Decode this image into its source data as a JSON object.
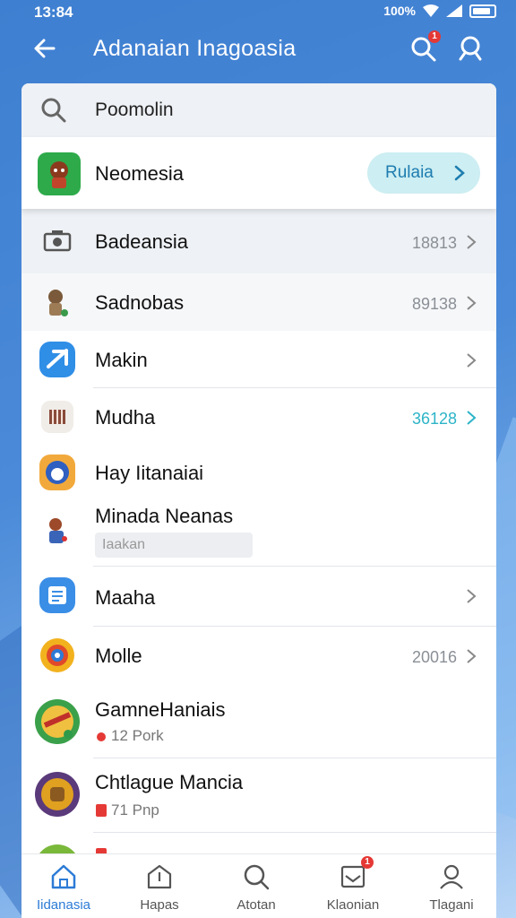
{
  "status": {
    "time": "13:84",
    "battery_text": "100%"
  },
  "appbar": {
    "title": "Adanaian Inagoasia",
    "notif_count": "1"
  },
  "search": {
    "text": "Poomolin"
  },
  "featured": {
    "name": "Neomesia",
    "button_label": "Rulaia"
  },
  "rows": [
    {
      "label": "Badeansia",
      "value": "18813"
    },
    {
      "label": "Sadnobas",
      "value": "89138"
    },
    {
      "label": "Makin",
      "value": ""
    },
    {
      "label": "Mudha",
      "value": "36128"
    },
    {
      "label": "Hay Iitanaiai"
    },
    {
      "label": "Minada Neanas",
      "sub": "Iaakan"
    },
    {
      "label": "Maaha",
      "value": ""
    },
    {
      "label": "Molle",
      "value": "20016"
    },
    {
      "label": "GamneHaniais",
      "sub": "12 Pork"
    },
    {
      "label": "Chtlague Mancia",
      "sub": "71 Pnp"
    }
  ],
  "tabs": [
    {
      "label": "Iidanasia"
    },
    {
      "label": "Hapas"
    },
    {
      "label": "Atotan"
    },
    {
      "label": "Klaonian",
      "badge": "1"
    },
    {
      "label": "Tlagani"
    }
  ],
  "colors": {
    "accent": "#2c7bd6",
    "teal": "#2cb4c8",
    "header_bg": "#4a8ad8"
  }
}
